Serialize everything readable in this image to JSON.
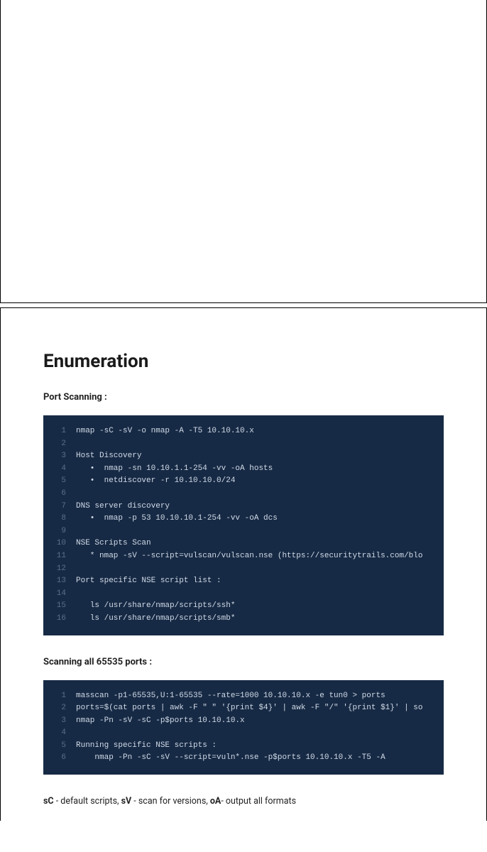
{
  "heading": "Enumeration",
  "sub1": "Port Scanning :",
  "code1": [
    "nmap -sC -sV -o nmap -A -T5 10.10.10.x",
    "",
    "Host Discovery",
    "   •  nmap -sn 10.10.1.1-254 -vv -oA hosts",
    "   •  netdiscover -r 10.10.10.0/24",
    "",
    "DNS server discovery",
    "   •  nmap -p 53 10.10.10.1-254 -vv -oA dcs",
    "",
    "NSE Scripts Scan",
    "   * nmap -sV --script=vulscan/vulscan.nse (https://securitytrails.com/blo",
    "",
    "Port specific NSE script list :",
    "",
    "   ls /usr/share/nmap/scripts/ssh*",
    "   ls /usr/share/nmap/scripts/smb*"
  ],
  "sub2": "Scanning all 65535 ports :",
  "code2": [
    "masscan -p1-65535,U:1-65535 --rate=1000 10.10.10.x -e tun0 > ports",
    "ports=$(cat ports | awk -F \" \" '{print $4}' | awk -F \"/\" '{print $1}' | so",
    "nmap -Pn -sV -sC -p$ports 10.10.10.x",
    "",
    "Running specific NSE scripts :",
    "    nmap -Pn -sC -sV --script=vuln*.nse -p$ports 10.10.10.x -T5 -A"
  ],
  "legend": {
    "t1b": "sC",
    "t1": " - default scripts, ",
    "t2b": "sV",
    "t2": " - scan for versions, ",
    "t3b": "oA",
    "t3": "- output all  formats"
  }
}
